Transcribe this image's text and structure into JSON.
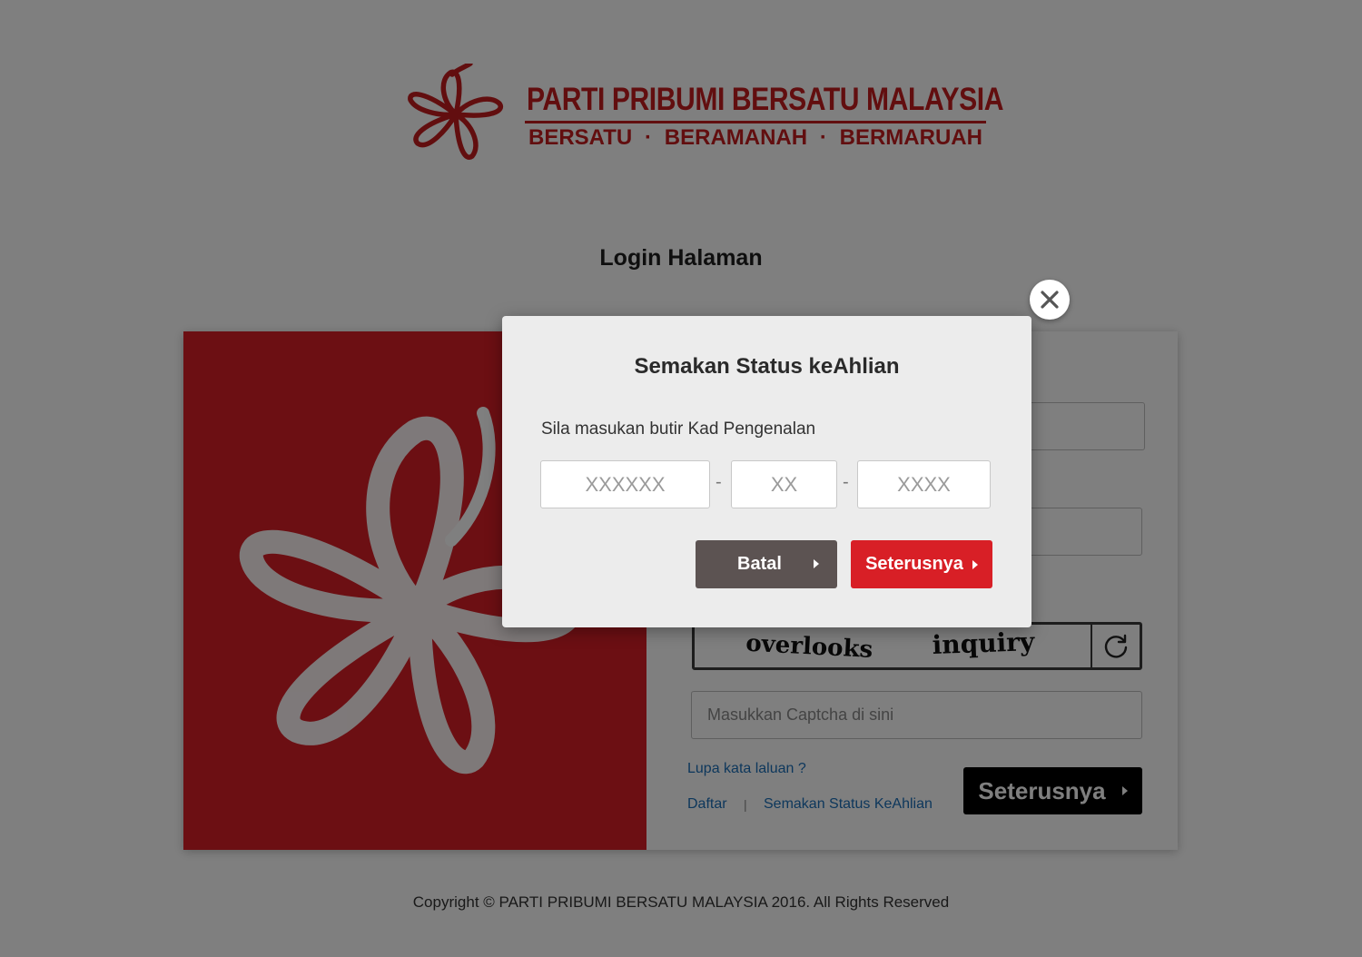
{
  "colors": {
    "brand_red": "#d81f26",
    "logo_red": "#c41d1f",
    "link_blue": "#1b6fb8",
    "cancel_gray": "#5c5352",
    "next_black": "#000000"
  },
  "header": {
    "logo_title": "PARTI PRIBUMI BERSATU MALAYSIA",
    "logo_motto": [
      "BERSATU",
      "·",
      "BERAMANAH",
      "·",
      "BERMARUAH"
    ]
  },
  "page": {
    "heading": "Login Halaman"
  },
  "login_form": {
    "captcha_words": [
      "overlooks",
      "inquiry"
    ],
    "captcha_placeholder": "Masukkan Captcha di sini",
    "refresh_icon": "refresh-icon",
    "forgot_password": "Lupa kata laluan ?",
    "register": "Daftar",
    "separator": "|",
    "check_status": "Semakan Status KeAhlian",
    "next_label": "Seterusnya"
  },
  "modal": {
    "title": "Semakan Status keAhlian",
    "instruction": "Sila masukan butir Kad Pengenalan",
    "ic_part1_placeholder": "XXXXXX",
    "ic_part2_placeholder": "XX",
    "ic_part3_placeholder": "XXXX",
    "dash": "-",
    "cancel_label": "Batal",
    "next_label": "Seterusnya",
    "close_icon": "close-icon"
  },
  "footer": {
    "copyright": "Copyright © PARTI PRIBUMI BERSATU MALAYSIA 2016. All Rights Reserved"
  }
}
